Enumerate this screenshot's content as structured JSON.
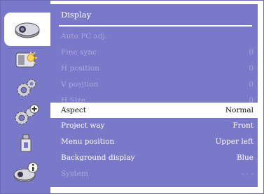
{
  "sidebar": {
    "tabs": [
      {
        "icon": "display-icon",
        "active": true
      },
      {
        "icon": "image-adjust-icon",
        "active": false
      },
      {
        "icon": "setting-gear-icon",
        "active": false
      },
      {
        "icon": "expanded-setting-icon",
        "active": false
      },
      {
        "icon": "usb-icon",
        "active": false
      },
      {
        "icon": "info-icon",
        "active": false
      }
    ]
  },
  "panel": {
    "title": "Display",
    "rows": [
      {
        "label": "Auto PC adj.",
        "value": "",
        "state": "disabled"
      },
      {
        "label": "Fine sync",
        "value": "0",
        "state": "disabled"
      },
      {
        "label": "H position",
        "value": "0",
        "state": "disabled"
      },
      {
        "label": "V position",
        "value": "0",
        "state": "disabled"
      },
      {
        "label": "H.Size",
        "value": "0",
        "state": "disabled"
      },
      {
        "label": "Aspect",
        "value": "Normal",
        "state": "selected"
      },
      {
        "label": "Project way",
        "value": "Front",
        "state": "enabled"
      },
      {
        "label": "Menu position",
        "value": "Upper left",
        "state": "enabled"
      },
      {
        "label": "Background display",
        "value": "Blue",
        "state": "enabled"
      },
      {
        "label": "System",
        "value": "- - -",
        "state": "disabled"
      }
    ]
  },
  "colors": {
    "menu_bg": "#7a78c9",
    "disabled_text": "#aaa7df",
    "selected_bg": "#ffffff"
  }
}
